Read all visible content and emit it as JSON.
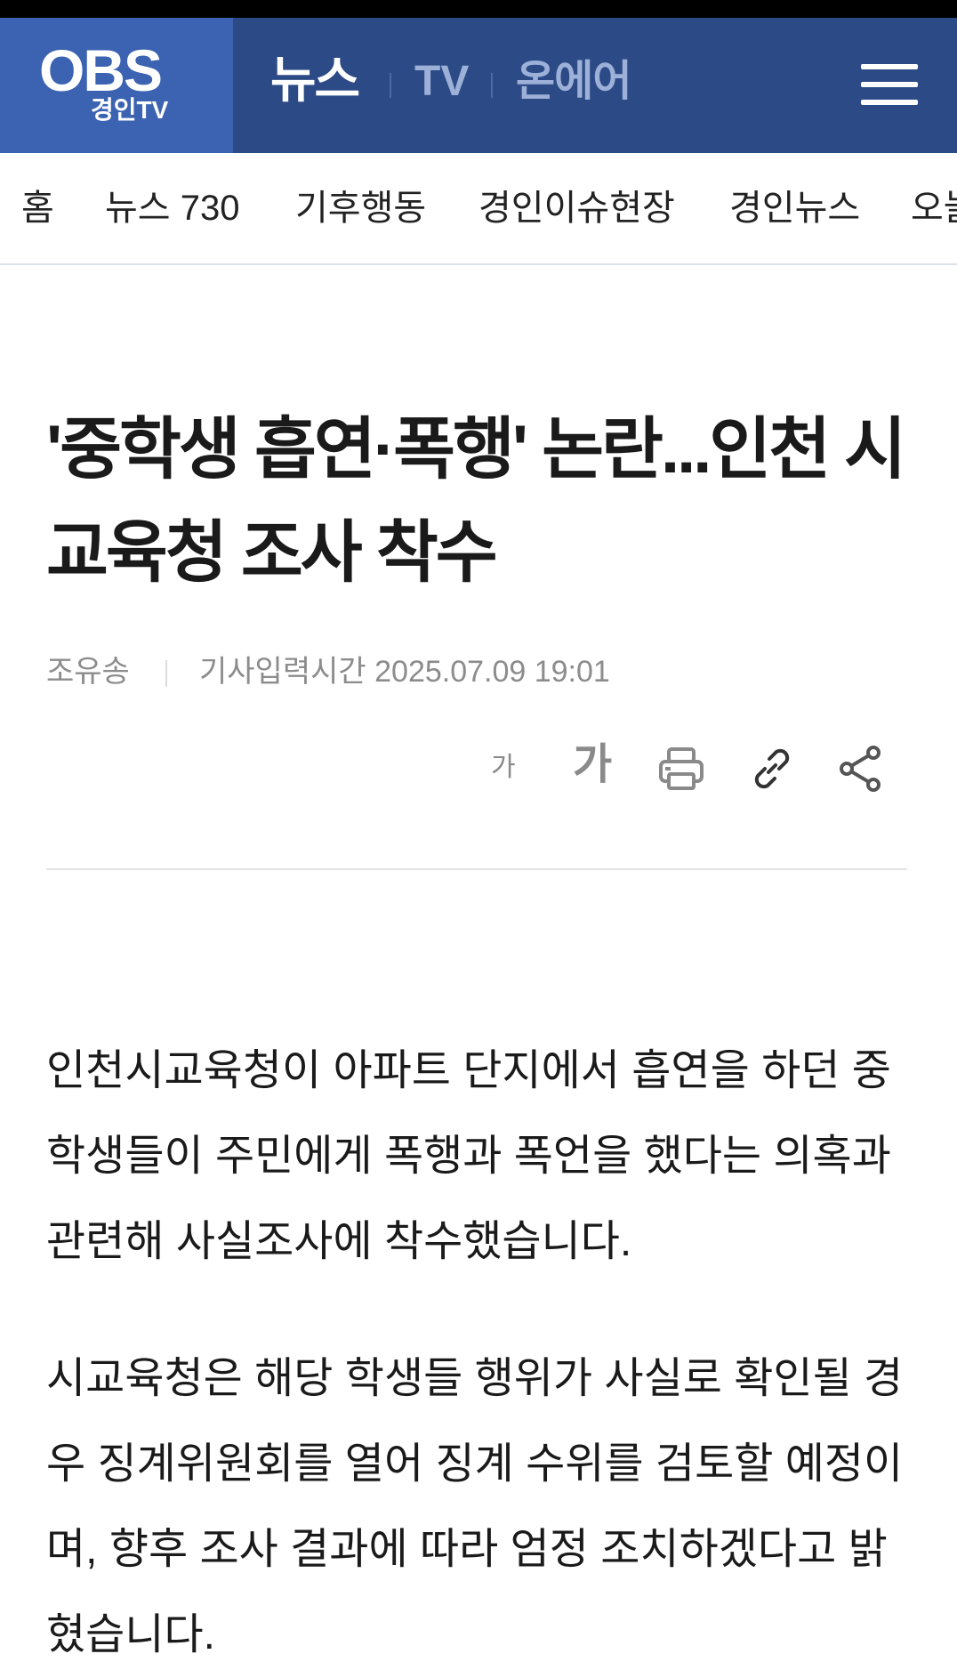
{
  "header": {
    "logo": {
      "main": "OBS",
      "sub": "경인TV"
    },
    "tabs": [
      {
        "label": "뉴스",
        "active": true
      },
      {
        "label": "TV",
        "active": false
      },
      {
        "label": "온에어",
        "active": false
      }
    ],
    "menu_icon": "hamburger-menu-icon"
  },
  "subnav": {
    "items": [
      "홈",
      "뉴스 730",
      "기후행동",
      "경인이슈현장",
      "경인뉴스",
      "오늘"
    ]
  },
  "article": {
    "title": "'중학생 흡연·폭행' 논란...인천 시교육청 조사 착수",
    "author": "조유송",
    "date_label": "기사입력시간 2025.07.09 19:01",
    "tools": {
      "font_small": "가",
      "font_large": "가",
      "print_icon": "printer-icon",
      "link_icon": "link-icon",
      "share_icon": "share-icon"
    },
    "paragraphs": [
      "인천시교육청이 아파트 단지에서 흡연을 하던 중학생들이 주민에게 폭행과 폭언을 했다는 의혹과 관련해 사실조사에 착수했습니다.",
      "시교육청은 해당 학생들 행위가 사실로 확인될 경우 징계위원회를 열어 징계 수위를 검토할 예정이며, 향후 조사 결과에 따라 엄정 조치하겠다고 밝혔습니다."
    ]
  },
  "colors": {
    "header_bg": "#2c4a86",
    "logo_bg": "#3b63b2",
    "inactive_tab": "#9cb0d8",
    "meta_text": "#8c8c8c"
  }
}
